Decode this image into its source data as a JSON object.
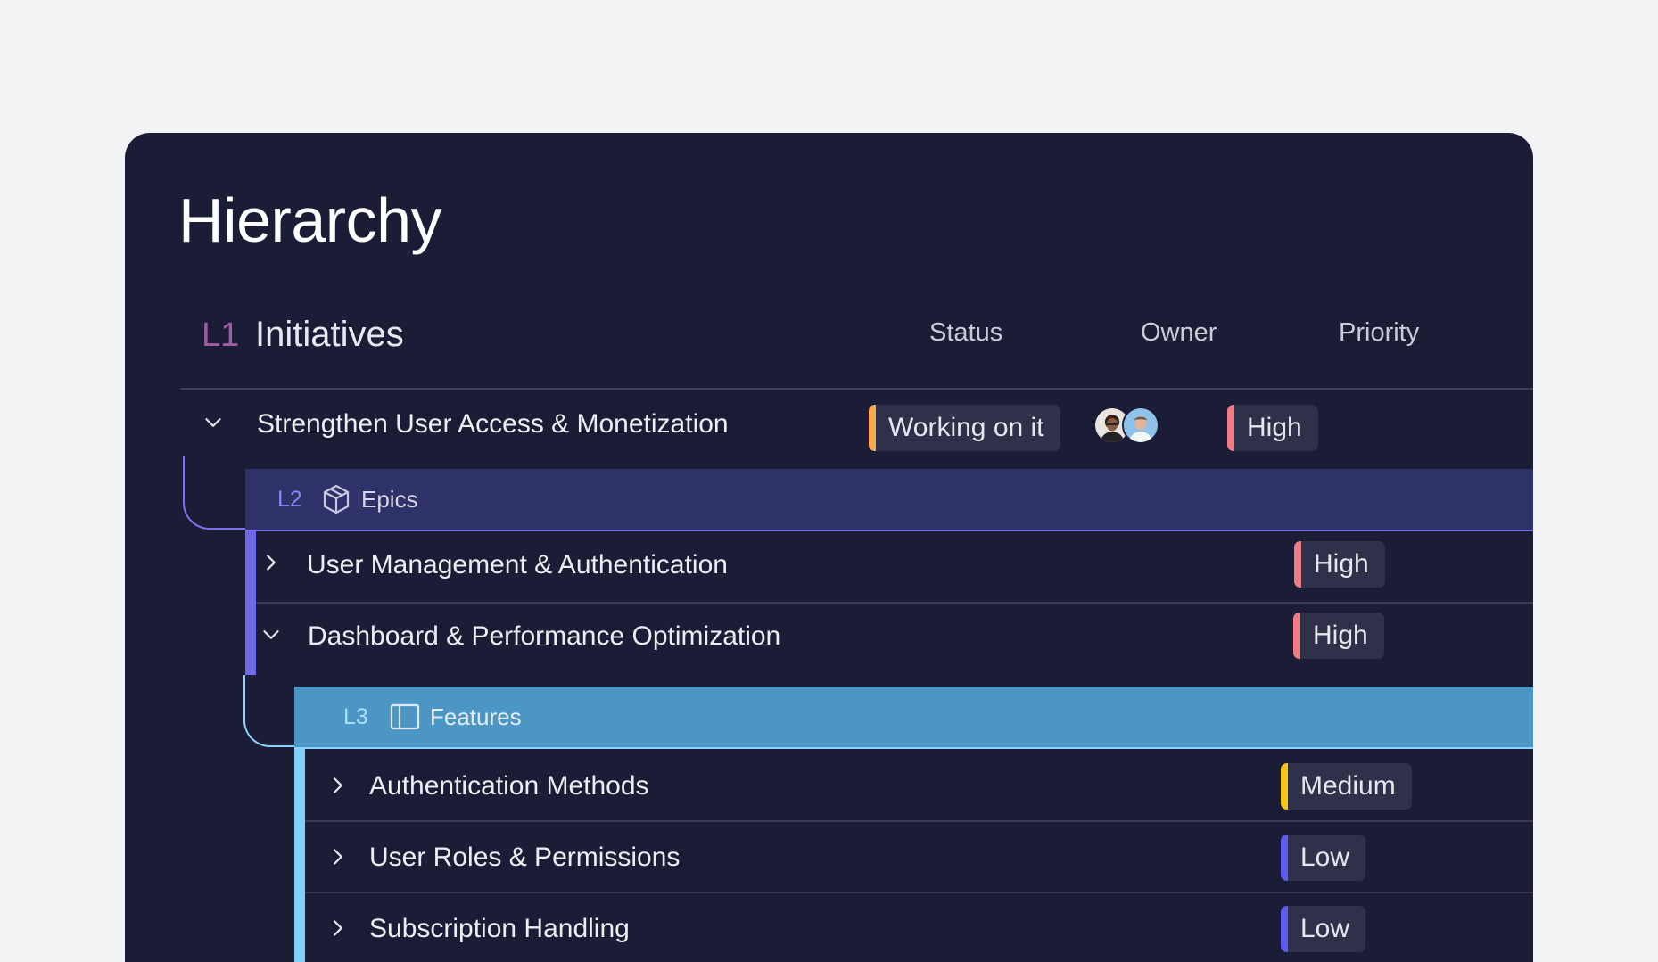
{
  "title": "Hierarchy",
  "header": {
    "level_tag": "L1",
    "level_label": "Initiatives",
    "columns": {
      "status": "Status",
      "owner": "Owner",
      "priority": "Priority"
    }
  },
  "initiative": {
    "label": "Strengthen User Access & Monetization",
    "status": "Working on it",
    "status_color": "#f9a94b",
    "priority": "High",
    "priority_color": "#f07b85",
    "owners": [
      "avatar-person-1",
      "avatar-person-2"
    ]
  },
  "epics_band": {
    "level_tag": "L2",
    "label": "Epics",
    "icon": "box-icon"
  },
  "epics": [
    {
      "label": "User Management & Authentication",
      "priority": "High",
      "priority_color": "#f07b85",
      "expanded": false
    },
    {
      "label": "Dashboard & Performance Optimization",
      "priority": "High",
      "priority_color": "#f07b85",
      "expanded": true
    }
  ],
  "features_band": {
    "level_tag": "L3",
    "label": "Features",
    "icon": "layout-panel-icon"
  },
  "features": [
    {
      "label": "Authentication Methods",
      "priority": "Medium",
      "priority_color": "#f5c518"
    },
    {
      "label": "User Roles & Permissions",
      "priority": "Low",
      "priority_color": "#5b5cf0"
    },
    {
      "label": "Subscription Handling",
      "priority": "Low",
      "priority_color": "#5b5cf0"
    }
  ]
}
